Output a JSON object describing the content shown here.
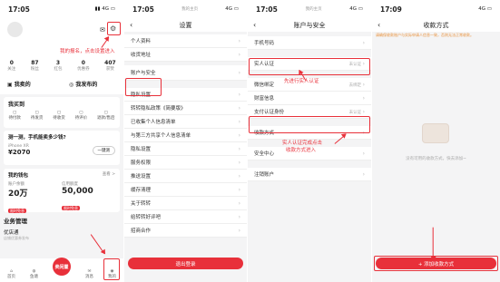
{
  "panel1": {
    "time": "17:05",
    "notify_label": "我的报名，点击设置进入",
    "stats": [
      {
        "value": "0",
        "label": "关注"
      },
      {
        "value": "87",
        "label": "粉丝"
      },
      {
        "value": "3",
        "label": "红包"
      },
      {
        "value": "0",
        "label": "优惠券"
      },
      {
        "value": "407",
        "label": "获赞"
      }
    ],
    "my_bought": "我卖的",
    "my_published": "我发布的",
    "my_trades_title": "我买到",
    "trade_items": [
      "待付款",
      "待发货",
      "待收货",
      "待评价",
      "退款/售后"
    ],
    "sell_prompt": "测一测，手机能卖多少钱?",
    "phone_model": "iPhone XR",
    "phone_price": "¥2070",
    "sell_button": "一键测",
    "wallet_title": "我的钱包",
    "wallet_link": "查看 >",
    "wallet_items": [
      {
        "label": "账户余额",
        "value": "20万",
        "badge": "限时免息"
      },
      {
        "label": "信用额度",
        "value": "50,000",
        "badge": "限时免息"
      }
    ],
    "business_title": "业务管理",
    "coupon_title": "优店通",
    "coupon_sub": "店铺优惠券发布",
    "nav": [
      "首页",
      "鱼塘",
      "卖闲置",
      "消息",
      "我的"
    ],
    "sell_center": "卖闲置"
  },
  "panel2": {
    "time": "17:05",
    "header": "我的主页",
    "title": "设置",
    "items": [
      "个人资料",
      "收货地址",
      "账户与安全",
      "隐私设置",
      "转转隐私政策《简要版》",
      "已收集个人信息清单",
      "与第三方共享个人信息清单",
      "隐私设置",
      "服务权限",
      "推送设置",
      "缓存清理",
      "关于转转",
      "给转转好评吧",
      "招商合作"
    ],
    "logout": "退出登录"
  },
  "panel3": {
    "time": "17:05",
    "header": "我的主页",
    "title": "账户与安全",
    "items": [
      {
        "label": "手机号码",
        "value": ""
      },
      {
        "label": "实人认证",
        "value": "未认证"
      },
      {
        "label": "微信绑定",
        "value": "去绑定"
      },
      {
        "label": "财富信息",
        "value": ""
      },
      {
        "label": "支付认证身份",
        "value": "未认证"
      },
      {
        "label": "收款方式",
        "value": ""
      },
      {
        "label": "安全中心",
        "value": ""
      },
      {
        "label": "注销账户",
        "value": ""
      }
    ],
    "annotation1": "先进行实人认证",
    "annotation2_line1": "实人认证完成点击",
    "annotation2_line2": "收款方式进入"
  },
  "panel4": {
    "time": "17:09",
    "header": "收款方式",
    "notice": "请确保收款账户与实际申请人信息一致，否则无法正常收款。",
    "empty_text": "没有可用的收款方式，快去添加~",
    "add_button": "+ 添加收款方式"
  },
  "colors": {
    "accent": "#e8303a",
    "highlight": "#e8303a"
  }
}
